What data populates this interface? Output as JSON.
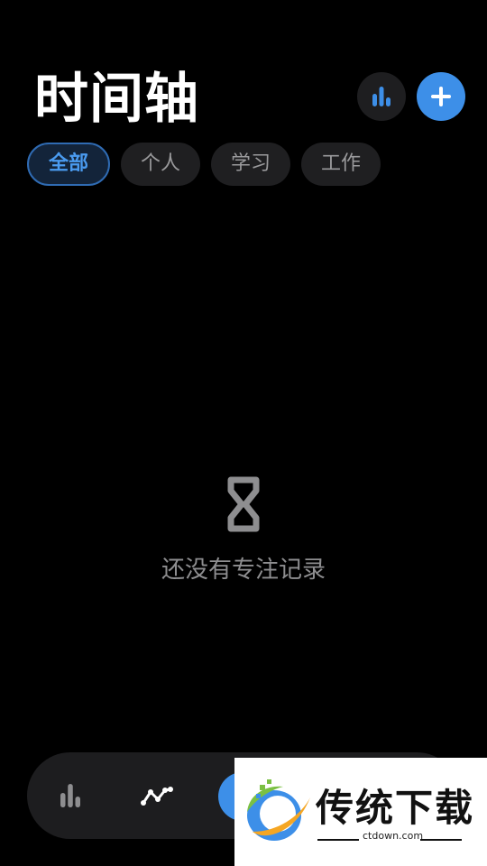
{
  "header": {
    "title": "时间轴"
  },
  "tabs": [
    {
      "label": "全部",
      "active": true
    },
    {
      "label": "个人",
      "active": false
    },
    {
      "label": "学习",
      "active": false
    },
    {
      "label": "工作",
      "active": false
    }
  ],
  "empty_state": {
    "message": "还没有专注记录",
    "icon": "hourglass-icon"
  },
  "bottom_nav": {
    "items": [
      "stats-icon",
      "trend-icon",
      "focus-button"
    ]
  },
  "watermark": {
    "title": "传统下载",
    "url": "ctdown.com"
  },
  "colors": {
    "accent": "#3d8fe8",
    "background": "#000000",
    "active_tab_text": "#4a9bf0"
  }
}
